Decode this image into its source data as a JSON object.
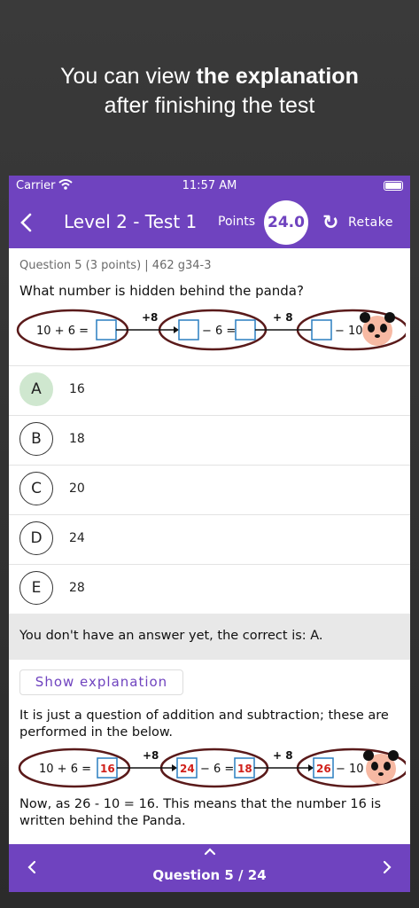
{
  "promo": {
    "line1_pre": "You can view ",
    "line1_bold": "the explanation",
    "line2": "after finishing the test"
  },
  "status_bar": {
    "carrier": "Carrier",
    "time": "11:57 AM",
    "wifi_icon": "wifi-icon",
    "battery_icon": "battery-icon"
  },
  "app_bar": {
    "back_icon": "chevron-left-icon",
    "title": "Level 2 - Test 1",
    "points_label": "Points",
    "points_value": "24.0",
    "retake_icon": "refresh-icon",
    "retake_label": "Retake"
  },
  "question": {
    "meta": "Question 5 (3 points) | 462 g34-3",
    "text": "What number is hidden behind the panda?",
    "figure": {
      "eq1": "10 + 6 =",
      "step1": "+8",
      "eq2": "− 6 =",
      "step2": "+ 8",
      "eq3": "− 10 ="
    }
  },
  "options": [
    {
      "letter": "A",
      "value": "16",
      "correct": true
    },
    {
      "letter": "B",
      "value": "18",
      "correct": false
    },
    {
      "letter": "C",
      "value": "20",
      "correct": false
    },
    {
      "letter": "D",
      "value": "24",
      "correct": false
    },
    {
      "letter": "E",
      "value": "28",
      "correct": false
    }
  ],
  "notice": "You don't have an answer yet, the correct is: A.",
  "explanation": {
    "button_label": "Show explanation",
    "text1": "It is just a question of addition and subtraction; these are performed in the below.",
    "figure": {
      "eq1": "10 + 6 =",
      "box1": "16",
      "step1": "+8",
      "box2": "24",
      "eq2": "− 6 =",
      "box3": "18",
      "step2": "+ 8",
      "box4": "26",
      "eq3": "− 10 ="
    },
    "text2": "Now, as 26 - 10 = 16. This means that the number 16 is written behind the Panda."
  },
  "bottom_bar": {
    "prev_icon": "chevron-left-icon",
    "up_icon": "chevron-up-icon",
    "next_icon": "chevron-right-icon",
    "label": "Question 5 / 24"
  },
  "colors": {
    "primary": "#6f43bf",
    "correct": "#cfe7cf",
    "ellipse": "#5a1a1a",
    "box": "#2a7fc1",
    "answer_red": "#d0201a"
  }
}
